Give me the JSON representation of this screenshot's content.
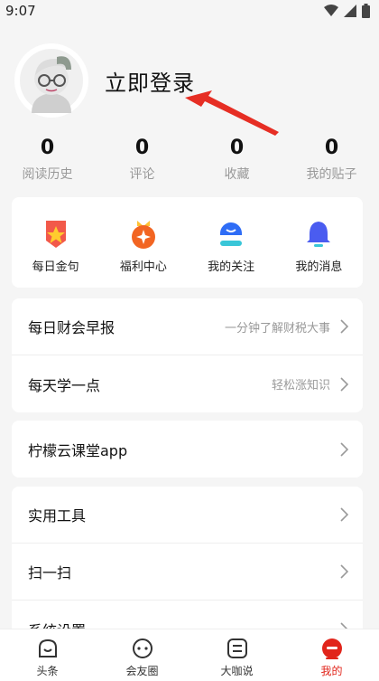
{
  "status_bar": {
    "time": "9:07"
  },
  "profile": {
    "login_label": "立即登录"
  },
  "stats": [
    {
      "value": "0",
      "label": "阅读历史"
    },
    {
      "value": "0",
      "label": "评论"
    },
    {
      "value": "0",
      "label": "收藏"
    },
    {
      "value": "0",
      "label": "我的贴子"
    }
  ],
  "quick_actions": [
    {
      "label": "每日金句",
      "icon": "star-badge-icon"
    },
    {
      "label": "福利中心",
      "icon": "gift-medal-icon"
    },
    {
      "label": "我的关注",
      "icon": "person-follow-icon"
    },
    {
      "label": "我的消息",
      "icon": "bell-icon"
    }
  ],
  "menu": {
    "news": [
      {
        "title": "每日财会早报",
        "hint": "一分钟了解财税大事"
      },
      {
        "title": "每天学一点",
        "hint": "轻松涨知识"
      }
    ],
    "app": [
      {
        "title": "柠檬云课堂app"
      }
    ],
    "tools": [
      {
        "title": "实用工具"
      },
      {
        "title": "扫一扫"
      },
      {
        "title": "系统设置"
      }
    ]
  },
  "tabs": [
    {
      "label": "头条",
      "icon": "smile-icon"
    },
    {
      "label": "会友圈",
      "icon": "chat-icon"
    },
    {
      "label": "大咖说",
      "icon": "list-icon"
    },
    {
      "label": "我的",
      "icon": "profile-icon",
      "active": true
    }
  ],
  "colors": {
    "accent": "#e1251b",
    "background": "#f5f5f5"
  }
}
